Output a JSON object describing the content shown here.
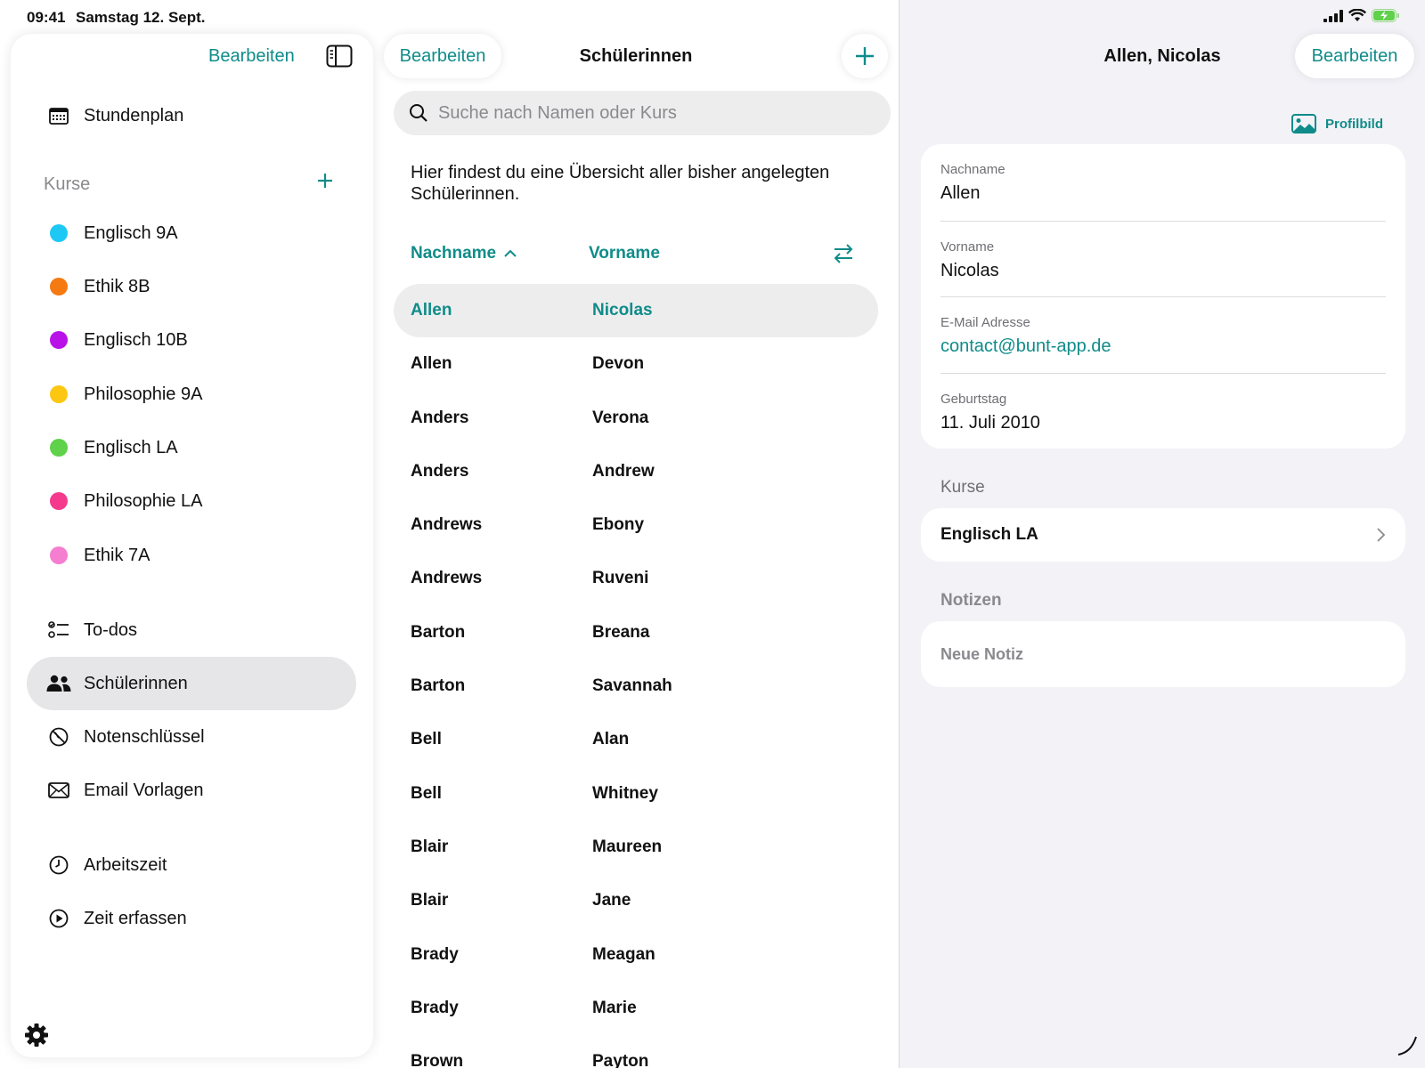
{
  "status_bar": {
    "time": "09:41",
    "date": "Samstag 12. Sept."
  },
  "sidebar": {
    "edit_label": "Bearbeiten",
    "timetable_label": "Stundenplan",
    "courses_header": "Kurse",
    "courses": [
      {
        "label": "Englisch 9A",
        "color": "#1ec8f5"
      },
      {
        "label": "Ethik 8B",
        "color": "#f57a12"
      },
      {
        "label": "Englisch 10B",
        "color": "#b812e8"
      },
      {
        "label": "Philosophie 9A",
        "color": "#fcc712"
      },
      {
        "label": "Englisch LA",
        "color": "#5fd14a"
      },
      {
        "label": "Philosophie LA",
        "color": "#f53a8e"
      },
      {
        "label": "Ethik 7A",
        "color": "#f57ed0"
      }
    ],
    "nav": [
      {
        "label": "To-dos"
      },
      {
        "label": "Schülerinnen"
      },
      {
        "label": "Notenschlüssel"
      },
      {
        "label": "Email Vorlagen"
      },
      {
        "label": "Arbeitszeit"
      },
      {
        "label": "Zeit erfassen"
      }
    ]
  },
  "students": {
    "edit_label": "Bearbeiten",
    "title": "Schülerinnen",
    "search_placeholder": "Suche nach Namen oder Kurs",
    "intro": "Hier findest du eine Übersicht aller bisher angelegten Schülerinnen.",
    "col_lastname": "Nachname",
    "col_firstname": "Vorname",
    "rows": [
      {
        "last": "Allen",
        "first": "Nicolas"
      },
      {
        "last": "Allen",
        "first": "Devon"
      },
      {
        "last": "Anders",
        "first": "Verona"
      },
      {
        "last": "Anders",
        "first": "Andrew"
      },
      {
        "last": "Andrews",
        "first": "Ebony"
      },
      {
        "last": "Andrews",
        "first": "Ruveni"
      },
      {
        "last": "Barton",
        "first": "Breana"
      },
      {
        "last": "Barton",
        "first": "Savannah"
      },
      {
        "last": "Bell",
        "first": "Alan"
      },
      {
        "last": "Bell",
        "first": "Whitney"
      },
      {
        "last": "Blair",
        "first": "Maureen"
      },
      {
        "last": "Blair",
        "first": "Jane"
      },
      {
        "last": "Brady",
        "first": "Meagan"
      },
      {
        "last": "Brady",
        "first": "Marie"
      },
      {
        "last": "Brown",
        "first": "Payton"
      }
    ]
  },
  "detail": {
    "title": "Allen, Nicolas",
    "edit_label": "Bearbeiten",
    "profile_image_label": "Profilbild",
    "fields": {
      "lastname_label": "Nachname",
      "lastname_value": "Allen",
      "firstname_label": "Vorname",
      "firstname_value": "Nicolas",
      "email_label": "E-Mail Adresse",
      "email_value": "contact@bunt-app.de",
      "birthday_label": "Geburtstag",
      "birthday_value": "11. Juli 2010"
    },
    "courses_header": "Kurse",
    "courses": [
      {
        "label": "Englisch LA"
      }
    ],
    "notes_header": "Notizen",
    "new_note_label": "Neue Notiz"
  },
  "colors": {
    "accent": "#0f8c8a",
    "selected_bg": "#ededee",
    "detail_bg": "#f2f2f7"
  }
}
